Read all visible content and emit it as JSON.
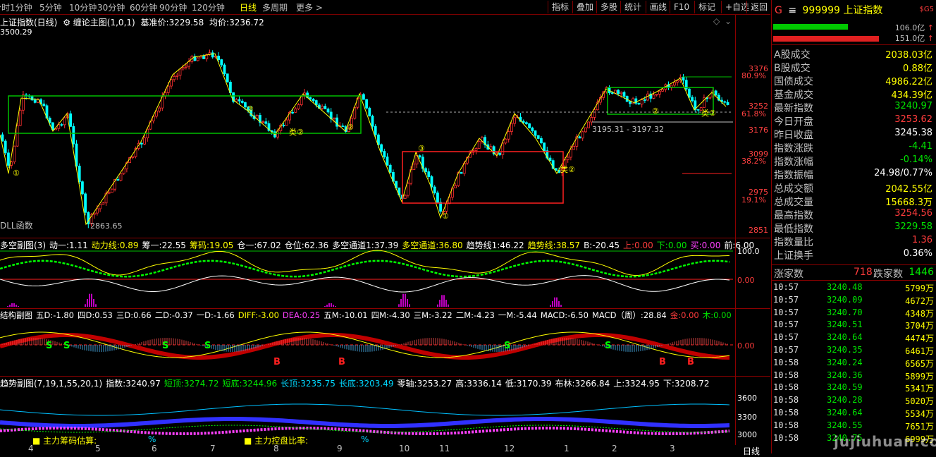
{
  "toolbar": {
    "periods": [
      "分时",
      "1分钟",
      "5分钟",
      "10分钟",
      "30分钟",
      "60分钟",
      "90分钟",
      "120分钟",
      "日线",
      "多周期",
      "更多 >"
    ],
    "active_period": "日线",
    "buttons": [
      "指标",
      "叠加",
      "多股",
      "统计",
      "画线",
      "F10",
      "标记",
      "+自选",
      "返回"
    ]
  },
  "main_pane": {
    "title": "上证指数(日线)",
    "indicator": "缠论主图(1,0,1)",
    "base_price_label": "基准价:",
    "base_price": "3229.58",
    "avg_label": "均价:",
    "avg_price": "3236.72",
    "top_value": "3500.29",
    "price_levels": [
      "3376",
      "3252",
      "3176",
      "3099",
      "2975",
      "2851"
    ],
    "pct_levels": [
      "80.9%",
      "61.8%",
      "38.2%",
      "19.1%"
    ],
    "low_annotation": "2863.65",
    "range_annotation": "3195.31 - 3197.32",
    "bottom_left_label": "DLL函数",
    "marks": [
      "①",
      "②",
      "类②",
      "③"
    ]
  },
  "pane2": {
    "label": "多空副图(3)",
    "values": [
      {
        "k": "动一:",
        "v": "1.11",
        "c": "white"
      },
      {
        "k": "动力线:",
        "v": "0.89",
        "c": "yel"
      },
      {
        "k": "筹一:",
        "v": "22.55",
        "c": "white"
      },
      {
        "k": "筹码:",
        "v": "19.05",
        "c": "yel"
      },
      {
        "k": "仓一:",
        "v": "67.02",
        "c": "white"
      },
      {
        "k": "仓位:",
        "v": "62.36",
        "c": "white"
      },
      {
        "k": "多空通道1:",
        "v": "37.39",
        "c": "white"
      },
      {
        "k": "多空通道:",
        "v": "36.80",
        "c": "yel"
      },
      {
        "k": "趋势线1:",
        "v": "46.22",
        "c": "white"
      },
      {
        "k": "趋势线:",
        "v": "38.57",
        "c": "yel"
      },
      {
        "k": "B:",
        "v": "-20.45",
        "c": "white"
      },
      {
        "k": "上:",
        "v": "0.00",
        "c": "red"
      },
      {
        "k": "下:",
        "v": "0.00",
        "c": "green"
      },
      {
        "k": "买:",
        "v": "0.00",
        "c": "mag"
      },
      {
        "k": "前:",
        "v": "6.00",
        "c": "white"
      }
    ],
    "axis": [
      "100.0",
      "0.00"
    ]
  },
  "pane3": {
    "label": "结构副图",
    "values": [
      {
        "k": "五D:",
        "v": "-1.80",
        "c": "white"
      },
      {
        "k": "四D:",
        "v": "0.53",
        "c": "white"
      },
      {
        "k": "三D:",
        "v": "0.66",
        "c": "white"
      },
      {
        "k": "二D:",
        "v": "-0.37",
        "c": "white"
      },
      {
        "k": "一D:",
        "v": "-1.66",
        "c": "white"
      },
      {
        "k": "DIFF:",
        "v": "-3.00",
        "c": "yel"
      },
      {
        "k": "DEA:",
        "v": "0.25",
        "c": "mag"
      },
      {
        "k": "五M:",
        "v": "-10.01",
        "c": "white"
      },
      {
        "k": "四M:",
        "v": "-4.30",
        "c": "white"
      },
      {
        "k": "三M:",
        "v": "-3.22",
        "c": "white"
      },
      {
        "k": "二M:",
        "v": "-4.23",
        "c": "white"
      },
      {
        "k": "一M:",
        "v": "-5.44",
        "c": "white"
      },
      {
        "k": "MACD:",
        "v": "-6.50",
        "c": "white"
      },
      {
        "k": "MACD（周）:",
        "v": "28.84",
        "c": "white"
      },
      {
        "k": "金:",
        "v": "0.00",
        "c": "red"
      },
      {
        "k": "木:",
        "v": "0.00",
        "c": "green"
      }
    ],
    "axis": [
      "0.00"
    ]
  },
  "pane4": {
    "label": "趋势副图(7,19,1,55,20,1)",
    "values": [
      {
        "k": "指数:",
        "v": "3240.97",
        "c": "white"
      },
      {
        "k": "短顶:",
        "v": "3274.72",
        "c": "green"
      },
      {
        "k": "短底:",
        "v": "3244.96",
        "c": "green"
      },
      {
        "k": "长顶:",
        "v": "3235.75",
        "c": "cyan"
      },
      {
        "k": "长底:",
        "v": "3203.49",
        "c": "cyan"
      },
      {
        "k": "零轴:",
        "v": "3253.27",
        "c": "white"
      },
      {
        "k": "高:",
        "v": "3336.14",
        "c": "white"
      },
      {
        "k": "低:",
        "v": "3170.39",
        "c": "white"
      },
      {
        "k": "布林:",
        "v": "3266.84",
        "c": "white"
      },
      {
        "k": "上:",
        "v": "3324.95",
        "c": "white"
      },
      {
        "k": "下:",
        "v": "3208.72",
        "c": "white"
      }
    ],
    "axis": [
      "3600",
      "3300",
      "3000"
    ],
    "bottom_text1": "主力筹码估算:",
    "bottom_text2": "主力控盘比率:",
    "pct_mark": "%"
  },
  "dates": [
    "4",
    "5",
    "6",
    "7",
    "8",
    "9",
    "10",
    "11",
    "12",
    "1",
    "2",
    "3"
  ],
  "period_badge": "日线",
  "sidebar": {
    "code_prefix": "G",
    "code": "999999",
    "name": "上证指数",
    "tag": "$G5",
    "bar1_val": "106.0亿",
    "bar2_val": "151.0亿",
    "stats": [
      {
        "k": "A股成交",
        "v": "2038.03亿",
        "c": "yel"
      },
      {
        "k": "B股成交",
        "v": "0.88亿",
        "c": "yel"
      },
      {
        "k": "国债成交",
        "v": "4986.22亿",
        "c": "yel"
      },
      {
        "k": "基金成交",
        "v": "434.39亿",
        "c": "yel"
      },
      {
        "k": "最新指数",
        "v": "3240.97",
        "c": "green"
      },
      {
        "k": "今日开盘",
        "v": "3253.62",
        "c": "red"
      },
      {
        "k": "昨日收盘",
        "v": "3245.38",
        "c": "white"
      },
      {
        "k": "指数涨跌",
        "v": "-4.41",
        "c": "green"
      },
      {
        "k": "指数涨幅",
        "v": "-0.14%",
        "c": "green"
      },
      {
        "k": "指数振幅",
        "v": "24.98/0.77%",
        "c": "white"
      },
      {
        "k": "总成交额",
        "v": "2042.55亿",
        "c": "yel"
      },
      {
        "k": "总成交量",
        "v": "15668.3万",
        "c": "yel"
      },
      {
        "k": "最高指数",
        "v": "3254.56",
        "c": "red"
      },
      {
        "k": "最低指数",
        "v": "3229.58",
        "c": "green"
      },
      {
        "k": "指数量比",
        "v": "1.36",
        "c": "red"
      },
      {
        "k": "上证换手",
        "v": "0.36%",
        "c": "white"
      }
    ],
    "up_label": "涨家数",
    "up_count": "718",
    "down_label": "跌家数",
    "down_count": "1446",
    "ticks": [
      {
        "t": "10:57",
        "p": "3240.48",
        "v": "5799万"
      },
      {
        "t": "10:57",
        "p": "3240.09",
        "v": "4672万"
      },
      {
        "t": "10:57",
        "p": "3240.70",
        "v": "4348万"
      },
      {
        "t": "10:57",
        "p": "3240.51",
        "v": "3704万"
      },
      {
        "t": "10:57",
        "p": "3240.64",
        "v": "4474万"
      },
      {
        "t": "10:57",
        "p": "3240.35",
        "v": "6461万"
      },
      {
        "t": "10:58",
        "p": "3240.24",
        "v": "6565万"
      },
      {
        "t": "10:58",
        "p": "3240.36",
        "v": "5899万"
      },
      {
        "t": "10:58",
        "p": "3240.59",
        "v": "5341万"
      },
      {
        "t": "10:58",
        "p": "3240.28",
        "v": "5020万"
      },
      {
        "t": "10:58",
        "p": "3240.64",
        "v": "5534万"
      },
      {
        "t": "10:58",
        "p": "3240.55",
        "v": "7651万"
      },
      {
        "t": "10:58",
        "p": "3240.75",
        "v": "6999万"
      }
    ],
    "watermark": "jujiuhuan.com"
  }
}
